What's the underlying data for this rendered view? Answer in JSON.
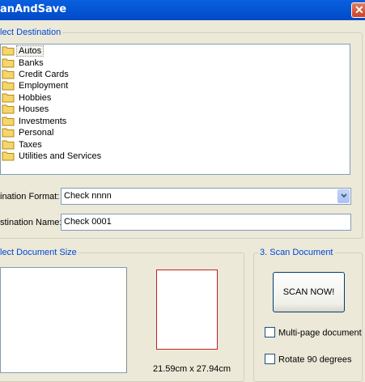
{
  "window": {
    "title": "anAndSave"
  },
  "destination_group": {
    "legend": "lect Destination"
  },
  "folders": [
    {
      "label": "Autos",
      "selected": true
    },
    {
      "label": "Banks"
    },
    {
      "label": "Credit Cards"
    },
    {
      "label": "Employment"
    },
    {
      "label": "Hobbies"
    },
    {
      "label": "Houses"
    },
    {
      "label": "Investments"
    },
    {
      "label": "Personal"
    },
    {
      "label": "Taxes"
    },
    {
      "label": "Utilities and Services"
    }
  ],
  "format": {
    "label": "ination Format:",
    "value": "Check nnnn"
  },
  "name": {
    "label": "stination Name:",
    "value": "Check 0001"
  },
  "doc_size_group": {
    "legend": "lect Document Size",
    "size_text": "21.59cm x 27.94cm"
  },
  "scan_group": {
    "legend": "3. Scan Document",
    "button_label": "SCAN NOW!",
    "multipage_label": "Multi-page document",
    "rotate_label": "Rotate 90 degrees"
  },
  "colors": {
    "accent": "#0046d5",
    "titlebar": "#0458d6",
    "paper_border": "#c02020"
  }
}
